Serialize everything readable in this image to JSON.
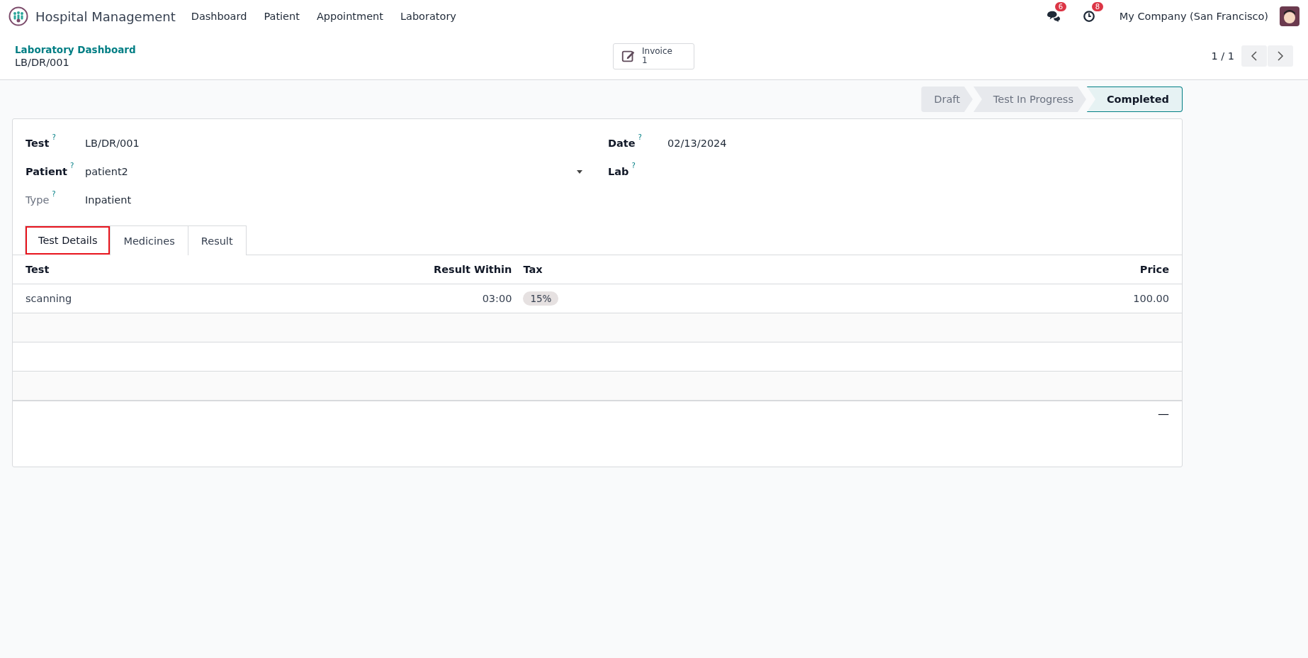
{
  "navbar": {
    "app_name": "Hospital Management",
    "menu": [
      "Dashboard",
      "Patient",
      "Appointment",
      "Laboratory"
    ],
    "messages_count": "6",
    "activities_count": "8",
    "company": "My Company (San Francisco)"
  },
  "control_panel": {
    "breadcrumb": "Laboratory Dashboard",
    "record": "LB/DR/001",
    "smart_button": {
      "label": "Invoice",
      "count": "1"
    },
    "pager": "1 / 1"
  },
  "status_bar": [
    {
      "label": "Draft",
      "selected": false
    },
    {
      "label": "Test In Progress",
      "selected": false
    },
    {
      "label": "Completed",
      "selected": true
    }
  ],
  "fields_left": [
    {
      "label": "Test",
      "value": "LB/DR/001",
      "help": "?",
      "bold": true,
      "kind": "text"
    },
    {
      "label": "Patient",
      "value": "patient2",
      "help": "?",
      "bold": true,
      "kind": "select"
    },
    {
      "label": "Type",
      "value": "Inpatient",
      "help": "?",
      "bold": false,
      "kind": "text"
    }
  ],
  "fields_right": [
    {
      "label": "Date",
      "value": "02/13/2024",
      "help": "?",
      "bold": true
    },
    {
      "label": "Lab",
      "help": "?",
      "bold": true
    }
  ],
  "tabs": [
    {
      "label": "Test Details",
      "selected": true,
      "highlighted": true
    },
    {
      "label": "Medicines",
      "selected": false,
      "highlighted": false
    },
    {
      "label": "Result",
      "selected": false,
      "highlighted": false
    }
  ],
  "table": {
    "columns": [
      "Test",
      "Result Within",
      "Tax",
      "Price"
    ],
    "rows": [
      {
        "test": "scanning",
        "result_within": "03:00",
        "tax": "15%",
        "price": "100.00"
      }
    ],
    "total": "—"
  }
}
